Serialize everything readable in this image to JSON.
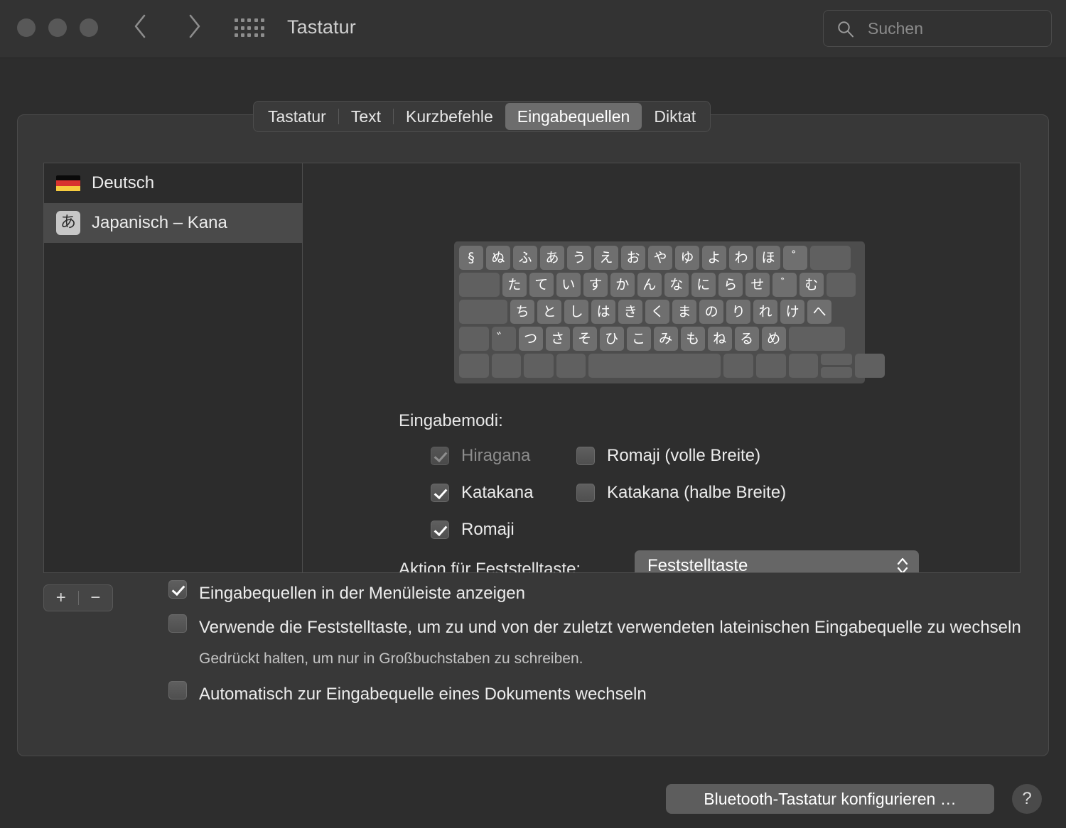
{
  "window": {
    "title": "Tastatur",
    "traffic_lights": [
      "close-button",
      "minimize-button",
      "zoom-button"
    ],
    "back_glyph": "‹",
    "forward_glyph": "›"
  },
  "search": {
    "placeholder": "Suchen",
    "icon": "search-icon"
  },
  "tabs": [
    {
      "label": "Tastatur",
      "active": false
    },
    {
      "label": "Text",
      "active": false
    },
    {
      "label": "Kurzbefehle",
      "active": false
    },
    {
      "label": "Eingabequellen",
      "active": true
    },
    {
      "label": "Diktat",
      "active": false
    }
  ],
  "sources": [
    {
      "label": "Deutsch",
      "icon": "german-flag-icon",
      "selected": false
    },
    {
      "label": "Japanisch – Kana",
      "icon": "kana-badge-icon",
      "badge": "あ",
      "selected": true
    }
  ],
  "keyboard_preview": {
    "rows": [
      [
        {
          "label": "§",
          "w": 1
        },
        {
          "label": "ぬ",
          "w": 1
        },
        {
          "label": "ふ",
          "w": 1
        },
        {
          "label": "あ",
          "w": 1
        },
        {
          "label": "う",
          "w": 1
        },
        {
          "label": "え",
          "w": 1
        },
        {
          "label": "お",
          "w": 1
        },
        {
          "label": "や",
          "w": 1
        },
        {
          "label": "ゆ",
          "w": 1
        },
        {
          "label": "よ",
          "w": 1
        },
        {
          "label": "わ",
          "w": 1
        },
        {
          "label": "ほ",
          "w": 1
        },
        {
          "label": "゚",
          "w": 1
        },
        {
          "label": "",
          "w": 1.6,
          "blank": true
        }
      ],
      [
        {
          "label": "",
          "w": 1.6,
          "blank": true
        },
        {
          "label": "た",
          "w": 1
        },
        {
          "label": "て",
          "w": 1
        },
        {
          "label": "い",
          "w": 1
        },
        {
          "label": "す",
          "w": 1
        },
        {
          "label": "か",
          "w": 1
        },
        {
          "label": "ん",
          "w": 1
        },
        {
          "label": "な",
          "w": 1
        },
        {
          "label": "に",
          "w": 1
        },
        {
          "label": "ら",
          "w": 1
        },
        {
          "label": "せ",
          "w": 1
        },
        {
          "label": "゙",
          "w": 1
        },
        {
          "label": "む",
          "w": 1
        },
        {
          "label": "",
          "w": 1.2,
          "blank": true
        }
      ],
      [
        {
          "label": "",
          "w": 1.9,
          "blank": true
        },
        {
          "label": "ち",
          "w": 1
        },
        {
          "label": "と",
          "w": 1
        },
        {
          "label": "し",
          "w": 1
        },
        {
          "label": "は",
          "w": 1
        },
        {
          "label": "き",
          "w": 1
        },
        {
          "label": "く",
          "w": 1
        },
        {
          "label": "ま",
          "w": 1
        },
        {
          "label": "の",
          "w": 1
        },
        {
          "label": "り",
          "w": 1
        },
        {
          "label": "れ",
          "w": 1
        },
        {
          "label": "け",
          "w": 1
        },
        {
          "label": "へ",
          "w": 1
        }
      ],
      [
        {
          "label": "",
          "w": 1.2,
          "blank": true
        },
        {
          "label": "゛",
          "w": 1,
          "blank": true
        },
        {
          "label": "つ",
          "w": 1
        },
        {
          "label": "さ",
          "w": 1
        },
        {
          "label": "そ",
          "w": 1
        },
        {
          "label": "ひ",
          "w": 1
        },
        {
          "label": "こ",
          "w": 1
        },
        {
          "label": "み",
          "w": 1
        },
        {
          "label": "も",
          "w": 1
        },
        {
          "label": "ね",
          "w": 1
        },
        {
          "label": "る",
          "w": 1
        },
        {
          "label": "め",
          "w": 1
        },
        {
          "label": "",
          "w": 2.2,
          "blank": true
        }
      ],
      [
        {
          "label": "",
          "w": 1.2,
          "blank": true
        },
        {
          "label": "",
          "w": 1.2,
          "blank": true
        },
        {
          "label": "",
          "w": 1.2,
          "blank": true
        },
        {
          "label": "",
          "w": 1.2,
          "blank": true
        },
        {
          "label": "",
          "w": 5,
          "blank": true
        },
        {
          "label": "",
          "w": 1.2,
          "blank": true
        },
        {
          "label": "",
          "w": 1.2,
          "blank": true
        },
        {
          "label": "",
          "w": 1.2,
          "blank": true
        },
        {
          "label": "",
          "w": 1.2,
          "blank": true,
          "arrows": true
        },
        {
          "label": "",
          "w": 1.2,
          "blank": true
        }
      ]
    ]
  },
  "input_modes": {
    "label": "Eingabemodi:",
    "items": [
      {
        "label": "Hiragana",
        "checked": true,
        "disabled": true,
        "col": "left"
      },
      {
        "label": "Romaji (volle Breite)",
        "checked": false,
        "disabled": false,
        "col": "right"
      },
      {
        "label": "Katakana",
        "checked": true,
        "disabled": false,
        "col": "left"
      },
      {
        "label": "Katakana (halbe Breite)",
        "checked": false,
        "disabled": false,
        "col": "right"
      },
      {
        "label": "Romaji",
        "checked": true,
        "disabled": false,
        "col": "left"
      }
    ]
  },
  "capslock": {
    "label": "Aktion für Feststelltaste:",
    "value": "Feststelltaste"
  },
  "list_controls": {
    "add_label": "+",
    "remove_label": "−"
  },
  "bottom_options": [
    {
      "label": "Eingabequellen in der Menüleiste anzeigen",
      "checked": true
    },
    {
      "label": "Verwende die Feststelltaste, um zu und von der zuletzt verwendeten lateinischen Eingabequelle zu wechseln",
      "checked": false
    },
    {
      "label": "Automatisch zur Eingabequelle eines Dokuments wechseln",
      "checked": false
    }
  ],
  "hint_text": "Gedrückt halten, um nur in Großbuchstaben zu schreiben.",
  "footer": {
    "bluetooth_button": "Bluetooth-Tastatur konfigurieren …",
    "help_button": "?"
  },
  "colors": {
    "window_bg": "#2d2d2d",
    "titlebar_bg": "#333333",
    "panel_bg": "#383838",
    "content_bg": "#2e2e2e",
    "selected_row": "#4a4a4a",
    "accent_tab": "#6d6d6d",
    "key_bg": "#6f6f6f",
    "text": "#ececec"
  }
}
